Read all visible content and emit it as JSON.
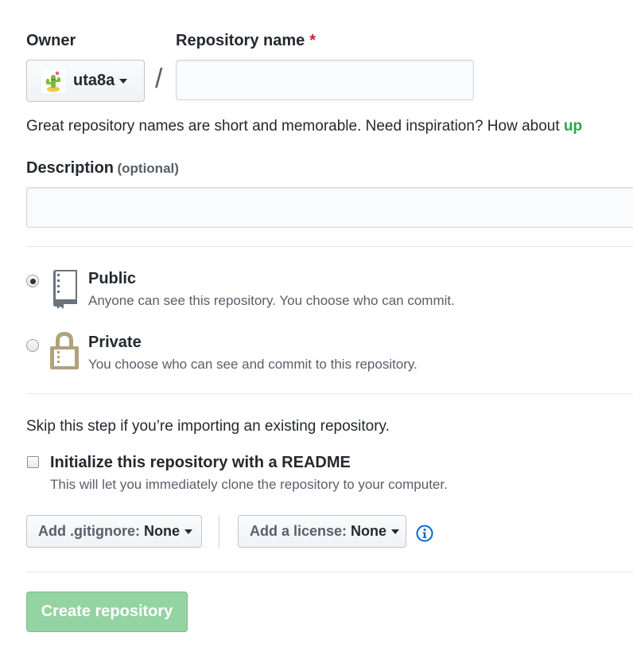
{
  "owner": {
    "label": "Owner",
    "selected": "uta8a"
  },
  "repo_name": {
    "label": "Repository name",
    "required_mark": "*",
    "value": "",
    "placeholder": ""
  },
  "separator": "/",
  "name_hint": {
    "text": "Great repository names are short and memorable. Need inspiration? How about ",
    "suggestion": "up"
  },
  "description": {
    "label": "Description",
    "optional": "(optional)",
    "value": ""
  },
  "visibility": {
    "selected": "public",
    "options": [
      {
        "title": "Public",
        "desc": "Anyone can see this repository. You choose who can commit."
      },
      {
        "title": "Private",
        "desc": "You choose who can see and commit to this repository."
      }
    ]
  },
  "import_hint": "Skip this step if you’re importing an existing repository.",
  "readme": {
    "checked": false,
    "label": "Initialize this repository with a README",
    "desc": "This will let you immediately clone the repository to your computer."
  },
  "gitignore": {
    "prefix": "Add .gitignore:",
    "value": "None"
  },
  "license": {
    "prefix": "Add a license:",
    "value": "None"
  },
  "submit_label": "Create repository",
  "colors": {
    "accent_green": "#28a745",
    "disabled_green": "#94d3a2",
    "info_blue": "#0366d6",
    "required_red": "#cb2431"
  },
  "icons": {
    "owner_avatar": "cactus-avatar",
    "public": "repo-book-icon",
    "private": "lock-icon",
    "info": "info-icon"
  }
}
